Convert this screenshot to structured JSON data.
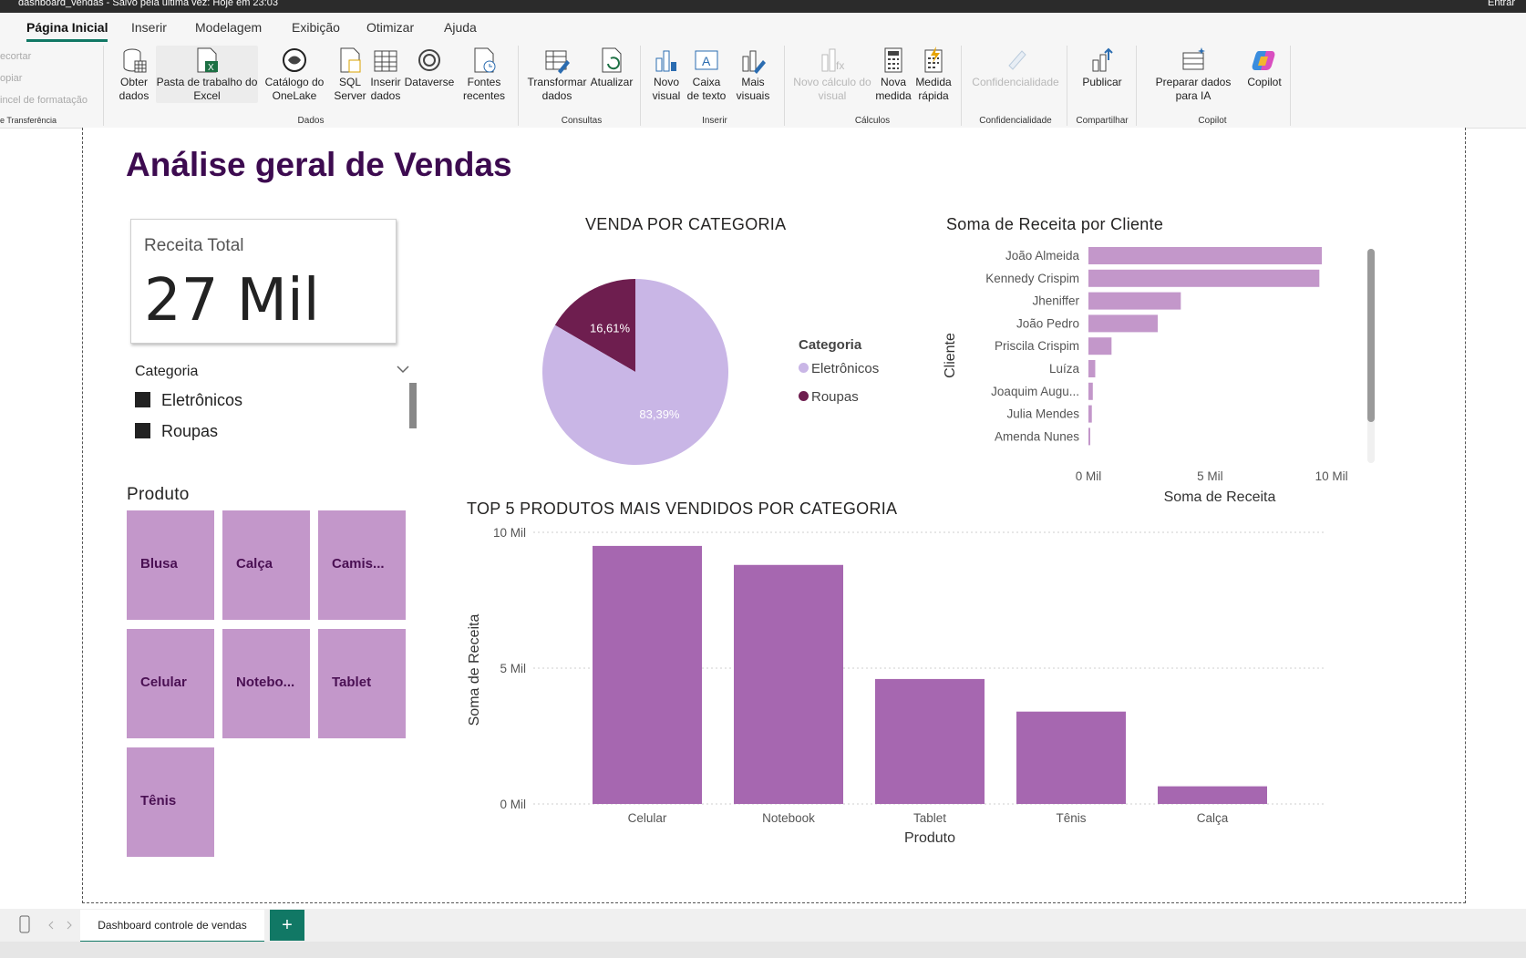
{
  "titlebar": {
    "title": "dashboard_vendas - Salvo pela última vez: Hoje em 23:03",
    "user": "Entrar"
  },
  "ribbon_tabs": [
    {
      "label": "Página Inicial",
      "active": true
    },
    {
      "label": "Inserir"
    },
    {
      "label": "Modelagem"
    },
    {
      "label": "Exibição"
    },
    {
      "label": "Otimizar"
    },
    {
      "label": "Ajuda"
    }
  ],
  "clipboard": {
    "cut": "ecortar",
    "copy": "opiar",
    "format": "incel de formatação",
    "group": "e Transferência"
  },
  "ribbon": {
    "get_data": "Obter dados",
    "excel": "Pasta de trabalho do Excel",
    "onelake": "Catálogo do OneLake",
    "sql": "SQL Server",
    "enter_data": "Inserir dados",
    "dataverse": "Dataverse",
    "recent": "Fontes recentes",
    "group_data": "Dados",
    "transform": "Transformar dados",
    "refresh": "Atualizar",
    "group_queries": "Consultas",
    "new_visual": "Novo visual",
    "textbox": "Caixa de texto",
    "more_visuals": "Mais visuais",
    "group_insert": "Inserir",
    "new_calc": "Novo cálculo do visual",
    "new_measure": "Nova medida",
    "quick_measure": "Medida rápida",
    "group_calc": "Cálculos",
    "sensitivity": "Confidencialidade",
    "group_sensitivity": "Confidencialidade",
    "publish": "Publicar",
    "group_share": "Compartilhar",
    "prepare_ai": "Preparar dados para IA",
    "copilot": "Copilot",
    "group_copilot": "Copilot"
  },
  "report": {
    "title": "Análise geral de Vendas",
    "card": {
      "label": "Receita Total",
      "value": "27 Mil"
    },
    "slicer": {
      "title": "Categoria",
      "items": [
        "Eletrônicos",
        "Roupas"
      ]
    },
    "treemap": {
      "title": "Produto",
      "items": [
        "Blusa",
        "Calça",
        "Camis...",
        "Celular",
        "Notebo...",
        "Tablet",
        "Tênis"
      ],
      "color": "#c397ca",
      "text_color": "#4a1053"
    }
  },
  "pie": {
    "title": "VENDA POR CATEGORIA",
    "legend_title": "Categoria",
    "slices": [
      {
        "name": "Eletrônicos",
        "value": 83.39,
        "label": "83,39%",
        "color": "#c9b6e6"
      },
      {
        "name": "Roupas",
        "value": 16.61,
        "label": "16,61%",
        "color": "#6e1e4f"
      }
    ]
  },
  "client_chart": {
    "title": "Soma de Receita por Cliente",
    "ylabel": "Cliente",
    "xlabel": "Soma de Receita",
    "ticks": [
      "0 Mil",
      "5 Mil",
      "10 Mil"
    ],
    "color": "#c397ca",
    "categories": [
      "João Almeida",
      "Kennedy Crispim",
      "Jheniffer",
      "João Pedro",
      "Priscila Crispim",
      "Luíza",
      "Joaquim Augu...",
      "Julia Mendes",
      "Amenda Nunes"
    ],
    "values": [
      9600,
      9500,
      3800,
      2850,
      950,
      280,
      180,
      140,
      60
    ]
  },
  "product_chart": {
    "title": "TOP 5 PRODUTOS MAIS VENDIDOS POR CATEGORIA",
    "ylabel": "Soma de Receita",
    "xlabel": "Produto",
    "ticks": [
      "0 Mil",
      "5 Mil",
      "10 Mil"
    ],
    "color": "#a667b0",
    "categories": [
      "Celular",
      "Notebook",
      "Tablet",
      "Tênis",
      "Calça"
    ],
    "values": [
      9500,
      8800,
      4600,
      3400,
      650
    ]
  },
  "chart_data": [
    {
      "type": "pie",
      "title": "VENDA POR CATEGORIA",
      "categories": [
        "Eletrônicos",
        "Roupas"
      ],
      "values": [
        83.39,
        16.61
      ]
    },
    {
      "type": "bar",
      "title": "Soma de Receita por Cliente",
      "xlabel": "Soma de Receita",
      "ylabel": "Cliente",
      "categories": [
        "João Almeida",
        "Kennedy Crispim",
        "Jheniffer",
        "João Pedro",
        "Priscila Crispim",
        "Luíza",
        "Joaquim Augu...",
        "Julia Mendes",
        "Amenda Nunes"
      ],
      "values": [
        9600,
        9500,
        3800,
        2850,
        950,
        280,
        180,
        140,
        60
      ],
      "xlim": [
        0,
        10000
      ]
    },
    {
      "type": "bar",
      "title": "TOP 5 PRODUTOS MAIS VENDIDOS POR CATEGORIA",
      "xlabel": "Produto",
      "ylabel": "Soma de Receita",
      "categories": [
        "Celular",
        "Notebook",
        "Tablet",
        "Tênis",
        "Calça"
      ],
      "values": [
        9500,
        8800,
        4600,
        3400,
        650
      ],
      "ylim": [
        0,
        10000
      ]
    }
  ],
  "footer": {
    "page_tab": "Dashboard controle de vendas",
    "add_page": "+"
  }
}
